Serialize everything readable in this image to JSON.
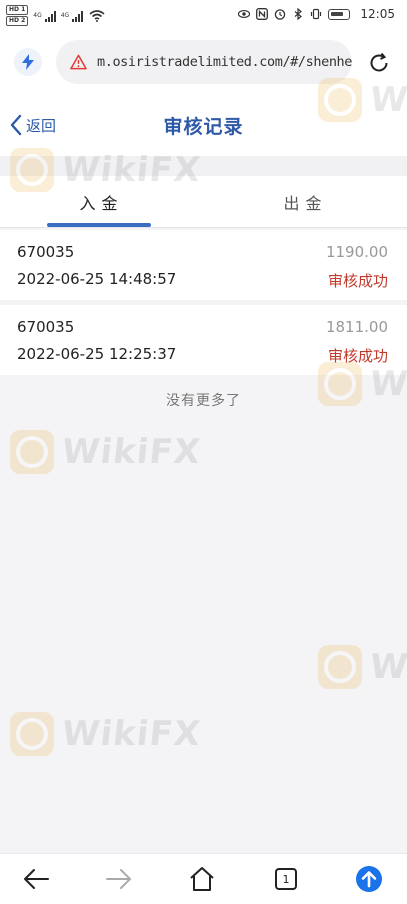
{
  "statusbar": {
    "sim1": "HD 1",
    "sim2": "HD 2",
    "net1": "4G",
    "net2": "4G",
    "time": "12:05"
  },
  "browser": {
    "url": "m.osiristradelimited.com/#/shenhe",
    "tab_count": "1"
  },
  "header": {
    "back_label": "返回",
    "title": "审核记录"
  },
  "tabs": [
    {
      "label": "入金",
      "active": true
    },
    {
      "label": "出金",
      "active": false
    }
  ],
  "records": [
    {
      "id": "670035",
      "amount": "1190.00",
      "time": "2022-06-25 14:48:57",
      "status": "审核成功"
    },
    {
      "id": "670035",
      "amount": "1811.00",
      "time": "2022-06-25 12:25:37",
      "status": "审核成功"
    }
  ],
  "footer_text": "没有更多了",
  "watermark": {
    "text": "WikiFX"
  },
  "colors": {
    "accent": "#2f5aa8",
    "tab_underline": "#3a6cc2",
    "status_success": "#c0392b",
    "upload_button": "#1a73e8",
    "warning": "#e53935"
  },
  "icons": {
    "lightning": "lightning-icon",
    "warning": "warning-triangle-icon",
    "reload": "reload-icon",
    "back": "chevron-left-icon",
    "nav_back": "arrow-left-icon",
    "nav_forward": "arrow-right-icon",
    "nav_home": "home-icon",
    "nav_tabs": "tabs-icon",
    "nav_upload": "arrow-up-circle-icon"
  }
}
